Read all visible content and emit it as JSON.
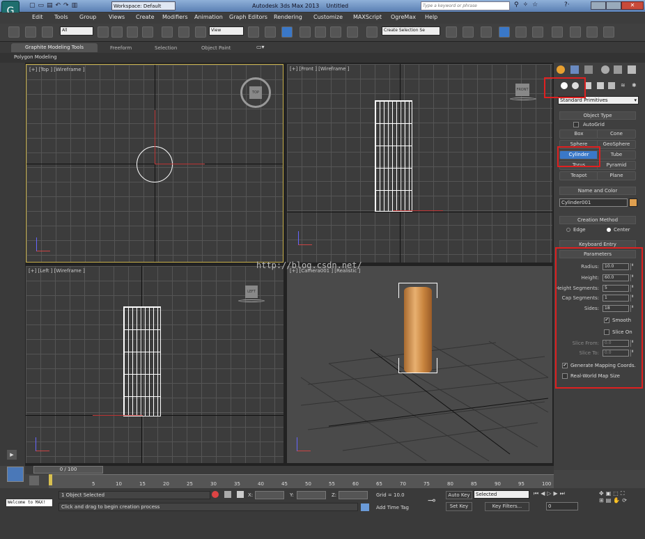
{
  "title": {
    "workspace": "Workspace: Default",
    "app": "Autodesk 3ds Max 2013",
    "doc": "Untitled",
    "search_placeholder": "Type a keyword or phrase"
  },
  "menu": [
    "Edit",
    "Tools",
    "Group",
    "Views",
    "Create",
    "Modifiers",
    "Animation",
    "Graph Editors",
    "Rendering",
    "Customize",
    "MAXScript",
    "OgreMax",
    "Help"
  ],
  "toolbar": {
    "filter": "All",
    "refcoord": "View",
    "selset": "Create Selection Se"
  },
  "ribbon": {
    "tabs": [
      "Graphite Modeling Tools",
      "Freeform",
      "Selection",
      "Object Paint"
    ],
    "sub": "Polygon Modeling"
  },
  "viewports": {
    "top": "[+] [Top ] [Wireframe ]",
    "front": "[+] [Front ] [Wireframe ]",
    "left": "[+] [Left ] [Wireframe ]",
    "camera": "[+] [Camera001 ] [Realistic ]",
    "watermark": "http://blog.csdn.net/",
    "vc_top": "TOP",
    "vc_front": "FRONT",
    "vc_left": "LEFT"
  },
  "panel": {
    "dropdown": "Standard Primitives",
    "object_type": "Object Type",
    "autogrid": "AutoGrid",
    "buttons": [
      "Box",
      "Cone",
      "Sphere",
      "GeoSphere",
      "Cylinder",
      "Tube",
      "Torus",
      "Pyramid",
      "Teapot",
      "Plane"
    ],
    "name_color": "Name and Color",
    "name": "Cylinder001",
    "name_swatch": "#e0a050",
    "creation_method": "Creation Method",
    "edge": "Edge",
    "center": "Center",
    "keyboard_entry": "Keyboard Entry",
    "parameters": "Parameters",
    "params": [
      {
        "label": "Radius:",
        "value": "10.0"
      },
      {
        "label": "Height:",
        "value": "60.0"
      },
      {
        "label": "Height Segments:",
        "value": "5"
      },
      {
        "label": "Cap Segments:",
        "value": "1"
      },
      {
        "label": "Sides:",
        "value": "18"
      }
    ],
    "smooth": "Smooth",
    "slice_on": "Slice On",
    "slice_from": {
      "label": "Slice From:",
      "value": "0.0"
    },
    "slice_to": {
      "label": "Slice To:",
      "value": "0.0"
    },
    "gen_map": "Generate Mapping Coords.",
    "real_world": "Real-World Map Size"
  },
  "timeline": {
    "frame": "0 / 100",
    "ticks": [
      "5",
      "10",
      "15",
      "20",
      "25",
      "30",
      "35",
      "40",
      "45",
      "50",
      "55",
      "60",
      "65",
      "70",
      "75",
      "80",
      "85",
      "90",
      "95",
      "100"
    ]
  },
  "status": {
    "maxscript": "Welcome to MAX!",
    "selected": "1 Object Selected",
    "prompt": "Click and drag to begin creation process",
    "x": "X:",
    "y": "Y:",
    "z": "Z:",
    "grid": "Grid = 10.0",
    "add_tag": "Add Time Tag",
    "autokey": "Auto Key",
    "setkey": "Set Key",
    "keymode": "Selected",
    "keyfilters": "Key Filters...",
    "frame_field": "0"
  },
  "colors": {
    "accent": "#e02020",
    "selected_btn": "#3a78c8",
    "object": "#d4924a"
  }
}
